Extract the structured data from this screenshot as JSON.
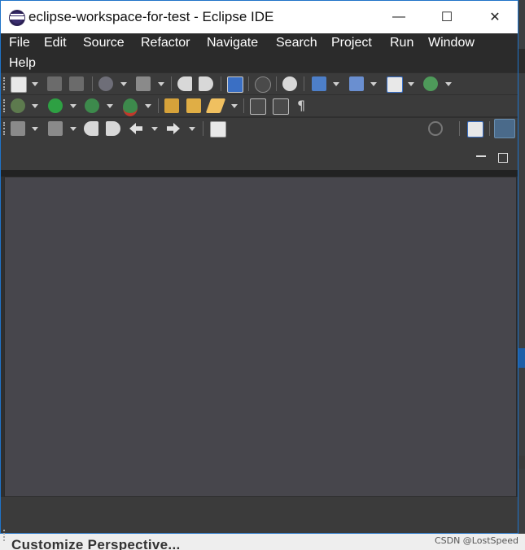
{
  "window": {
    "title": "eclipse-workspace-for-test - Eclipse IDE",
    "controls": {
      "minimize": "—",
      "maximize": "☐",
      "close": "✕"
    }
  },
  "menu": {
    "items": [
      "File",
      "Edit",
      "Source",
      "Refactor",
      "Navigate",
      "Search",
      "Project",
      "Run",
      "Window",
      "Help"
    ]
  },
  "toolbar_icons": {
    "row1": [
      "new-icon",
      "save-icon",
      "save-all-icon",
      "build-all-icon",
      "hammer-build-icon",
      "undo-icon",
      "redo-icon",
      "console-icon",
      "debug-inspect-icon",
      "refresh-icon",
      "new-c-project-icon",
      "new-class-icon",
      "new-c-file-icon",
      "gear-plugin-icon"
    ],
    "row2": [
      "bug-debug-icon",
      "run-icon",
      "coverage-icon",
      "profile-icon",
      "open-folder-icon",
      "open-type-icon",
      "highlight-icon",
      "show-whitespace-icon",
      "block-selection-icon",
      "pilcrow-icon"
    ],
    "row3": [
      "next-annotation-icon",
      "prev-annotation-icon",
      "back-edit-icon",
      "forward-edit-icon",
      "back-icon",
      "forward-icon",
      "pin-editor-icon",
      "search-icon",
      "open-perspective-icon",
      "c-perspective-icon"
    ]
  },
  "pilcrow": "¶",
  "behind_text": "Customize Perspective...",
  "watermark": "CSDN @LostSpeed",
  "colors": {
    "accent": "#1f73c8",
    "editor_bg": "#47464c",
    "menubar_bg": "#2b2b2b"
  }
}
